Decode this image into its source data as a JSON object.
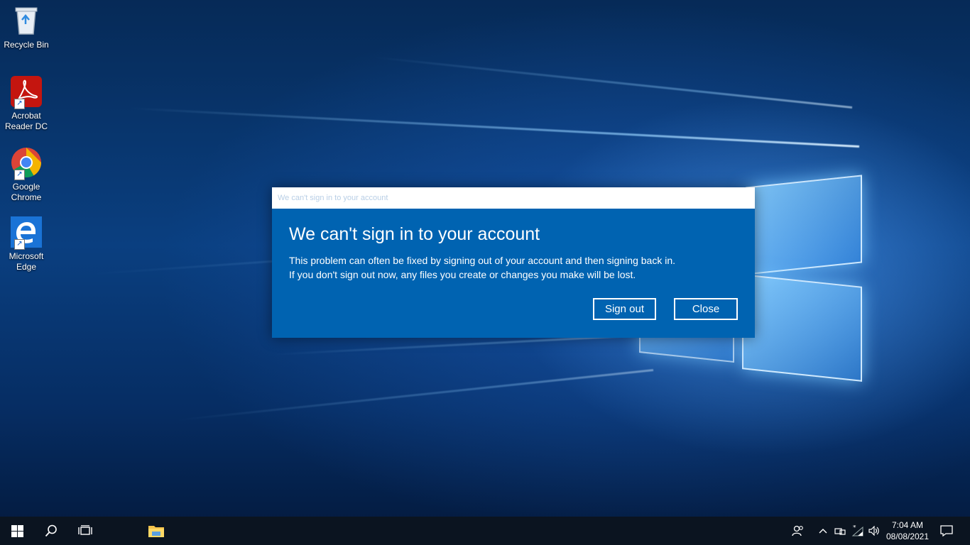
{
  "desktop_icons": [
    {
      "label_l1": "Recycle Bin",
      "label_l2": "",
      "icon": "recycle-bin-icon"
    },
    {
      "label_l1": "Acrobat",
      "label_l2": "Reader DC",
      "icon": "acrobat-reader-icon"
    },
    {
      "label_l1": "Google",
      "label_l2": "Chrome",
      "icon": "chrome-icon"
    },
    {
      "label_l1": "Microsoft",
      "label_l2": "Edge",
      "icon": "edge-icon"
    }
  ],
  "dialog": {
    "window_title": "We can't sign in to your account",
    "heading": "We can't sign in to your account",
    "message_line1": "This problem can often be fixed by signing out of your account and then signing back in.",
    "message_line2": "If you don't sign out now, any files you create or changes you make will be lost.",
    "sign_out_label": "Sign out",
    "close_label": "Close"
  },
  "taskbar": {
    "time": "7:04 AM",
    "date": "08/08/2021",
    "icons": [
      "windows-start-icon",
      "search-icon",
      "task-view-icon",
      "file-explorer-icon",
      "people-icon",
      "chevron-up-icon",
      "network-icon",
      "wifi-icon",
      "volume-icon",
      "notification-icon"
    ]
  },
  "colors": {
    "dialog_blue": "#0063b1",
    "taskbar": "#0b1420"
  }
}
